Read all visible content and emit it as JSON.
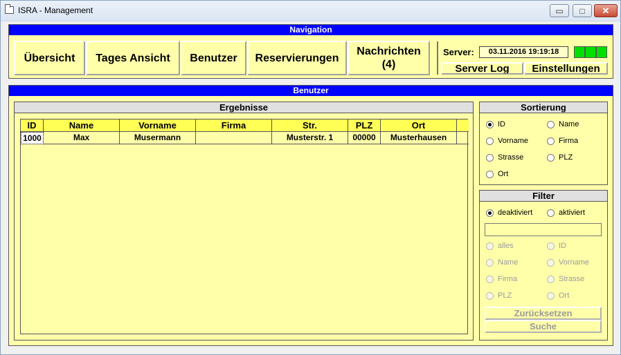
{
  "window": {
    "title": "ISRA - Management",
    "minimize": "▭",
    "maximize": "□",
    "close": "✕"
  },
  "navigation": {
    "header": "Navigation",
    "buttons": [
      "Übersicht",
      "Tages Ansicht",
      "Benutzer",
      "Reservierungen",
      "Nachrichten\n(4)"
    ],
    "server_label": "Server:",
    "server_time": "03.11.2016 19:19:18",
    "status_color": "#00e000",
    "server_log": "Server Log",
    "settings": "Einstellungen"
  },
  "benutzer": {
    "header": "Benutzer",
    "results": {
      "title": "Ergebnisse",
      "columns": [
        "ID",
        "Name",
        "Vorname",
        "Firma",
        "Str.",
        "PLZ",
        "Ort"
      ],
      "rows": [
        [
          "1000",
          "Max",
          "Musermann",
          "",
          "Musterstr. 1",
          "00000",
          "Musterhausen"
        ]
      ]
    },
    "sorting": {
      "title": "Sortierung",
      "options": [
        "ID",
        "Name",
        "Vorname",
        "Firma",
        "Strasse",
        "PLZ",
        "Ort"
      ],
      "selected": "ID"
    },
    "filter": {
      "title": "Filter",
      "mode_off": "deaktiviert",
      "mode_on": "aktiviert",
      "selected_mode": "deaktiviert",
      "input_value": "",
      "fields": [
        "alles",
        "ID",
        "Name",
        "Vorname",
        "Firma",
        "Strasse",
        "PLZ",
        "Ort"
      ],
      "reset": "Zurücksetzen",
      "search": "Suche"
    }
  }
}
